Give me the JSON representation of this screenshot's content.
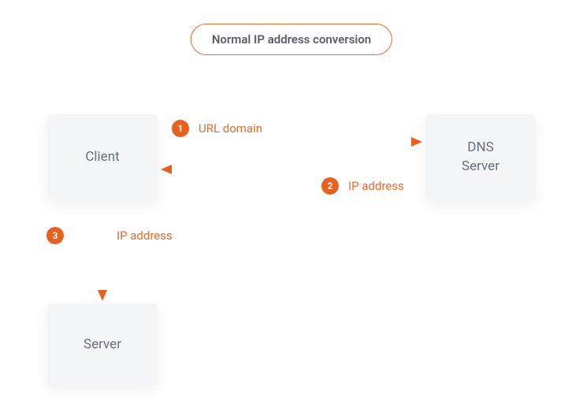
{
  "title": "Normal IP address conversion",
  "colors": {
    "accent": "#e9601e",
    "accent_light": "#f08248",
    "box_bg": "#f4f5f6",
    "text": "#6a7078"
  },
  "nodes": {
    "client": {
      "label": "Client"
    },
    "dns": {
      "label": "DNS\nServer"
    },
    "server": {
      "label": "Server"
    }
  },
  "arrows": [
    {
      "id": "a1",
      "from": "client",
      "to": "dns",
      "badge": "1",
      "label": "URL domain"
    },
    {
      "id": "a2",
      "from": "dns",
      "to": "client",
      "badge": "2",
      "label": "IP address"
    },
    {
      "id": "a3",
      "from": "client",
      "to": "server",
      "badge": "3",
      "label": "IP address"
    }
  ]
}
